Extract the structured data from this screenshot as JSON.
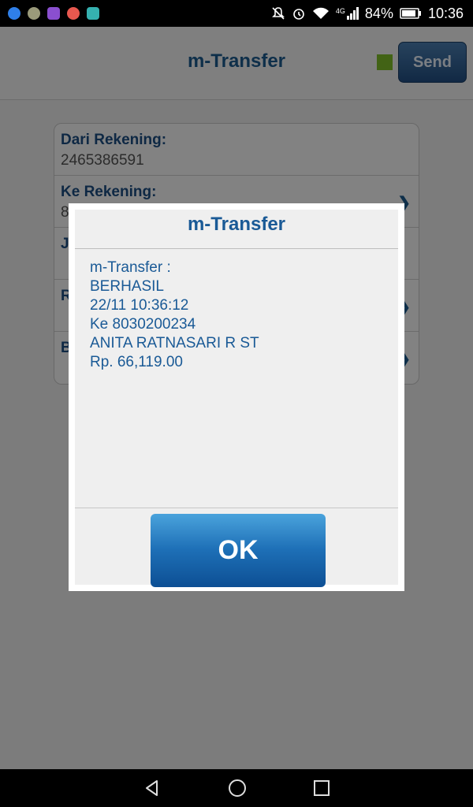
{
  "status_bar": {
    "app_icons": [
      {
        "name": "chat-app-icon",
        "color": "#2f7fe8"
      },
      {
        "name": "gallery-app-icon",
        "color": "#9a9a7a"
      },
      {
        "name": "video-app-icon",
        "color": "#8a4fcf"
      },
      {
        "name": "camera-app-icon",
        "color": "#e8584f"
      },
      {
        "name": "bulb-app-icon",
        "color": "#35b1b0"
      }
    ],
    "network": "4G",
    "battery": "84%",
    "time": "10:36"
  },
  "header": {
    "title": "m-Transfer",
    "send_label": "Send",
    "indicator_color": "#7fbf2a"
  },
  "form": {
    "rows": [
      {
        "label": "Dari Rekening:",
        "value": "2465386591"
      },
      {
        "label": "Ke Rekening:",
        "value": "8"
      },
      {
        "label": "J",
        "value": ""
      },
      {
        "label": "R",
        "value": ""
      },
      {
        "label": "B",
        "value": ""
      }
    ]
  },
  "dialog": {
    "title": "m-Transfer",
    "lines": [
      "m-Transfer :",
      "BERHASIL",
      "22/11 10:36:12",
      "Ke 8030200234",
      "ANITA RATNASARI R ST",
      "Rp. 66,119.00"
    ],
    "ok_label": "OK"
  }
}
